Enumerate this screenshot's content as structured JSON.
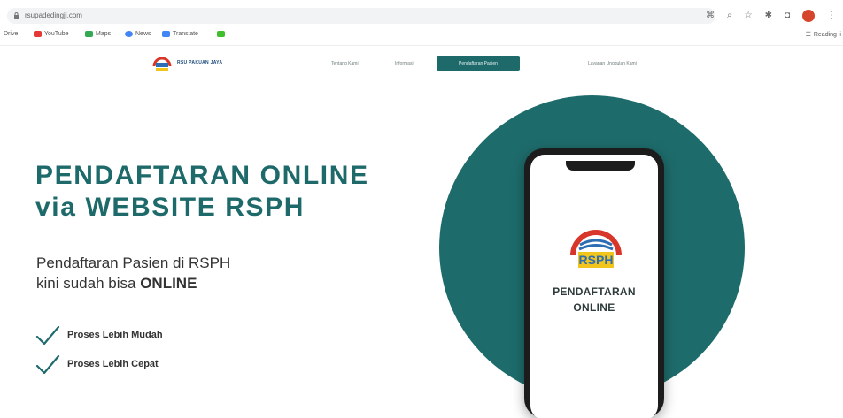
{
  "browser": {
    "url": "rsupadedingji.com",
    "bookmarks": [
      {
        "label": "Drive",
        "icon": "drive-icon",
        "color": "#999999"
      },
      {
        "label": "YouTube",
        "icon": "youtube-icon",
        "color": "#e53935"
      },
      {
        "label": "Maps",
        "icon": "maps-icon",
        "color": "#34a853"
      },
      {
        "label": "News",
        "icon": "news-icon",
        "color": "#4285f4"
      },
      {
        "label": "Translate",
        "icon": "translate-icon",
        "color": "#4285f4"
      }
    ],
    "reading_list": "Reading li"
  },
  "site": {
    "logo_text": "RSU PAKUAN JAYA",
    "nav": [
      "Tentang Kami",
      "Informasi",
      "Pendaftaran Pasien",
      "Layanan Unggulan Kami"
    ],
    "active_nav": "Pendaftaran Pasien"
  },
  "hero": {
    "title_line1": "PENDAFTARAN ONLINE",
    "title_line2": "via WEBSITE RSPH",
    "subtitle_line1": "Pendaftaran Pasien di RSPH",
    "subtitle_line2_prefix": "kini sudah bisa",
    "subtitle_line2_bold": "ONLINE",
    "features": [
      "Proses Lebih Mudah",
      "Proses Lebih Cepat"
    ]
  },
  "phone": {
    "logo_text": "RSPH",
    "title_line1": "PENDAFTARAN",
    "title_line2": "ONLINE"
  },
  "colors": {
    "brand_teal": "#1e6a6b",
    "logo_red": "#d9362b",
    "logo_blue": "#2c6db3",
    "logo_yellow": "#f1c51c"
  }
}
